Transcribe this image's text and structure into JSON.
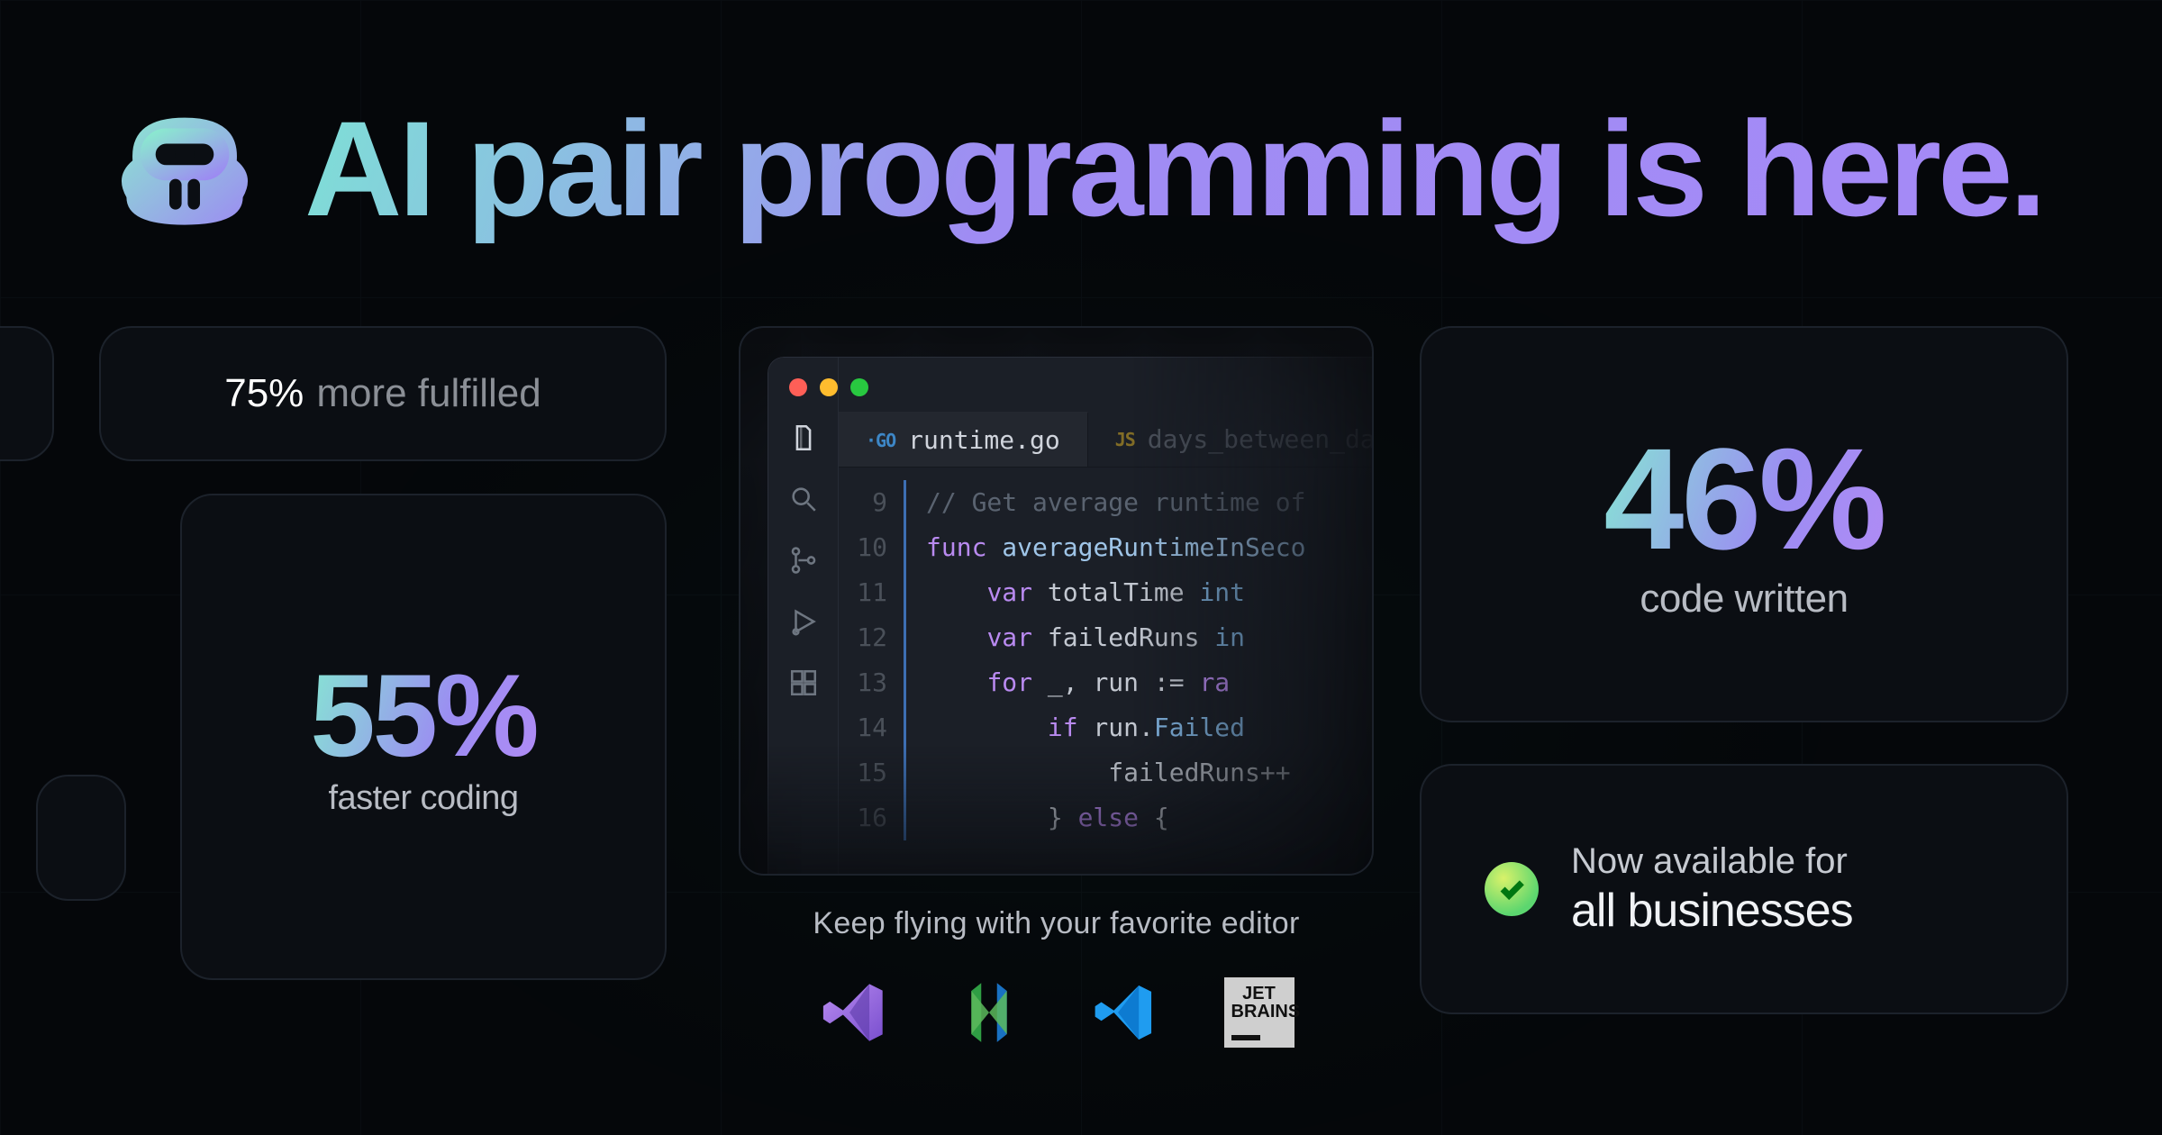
{
  "hero": {
    "title": "AI pair programming is here."
  },
  "stats": {
    "fulfilled": {
      "value": "75%",
      "label": "more fulfilled"
    },
    "faster": {
      "value": "55%",
      "label": "faster coding"
    },
    "written": {
      "value": "46%",
      "label": "code written"
    }
  },
  "availability": {
    "line1": "Now available for",
    "line2": "all businesses"
  },
  "editor": {
    "tabs": [
      {
        "lang": "GO",
        "name": "runtime.go",
        "active": true
      },
      {
        "lang": "JS",
        "name": "days_between_da",
        "active": false
      }
    ],
    "gutter_start": 9,
    "lines": [
      {
        "n": 9,
        "html": "<span class='c-comment'>// Get average runtime of</span>"
      },
      {
        "n": 10,
        "html": "<span class='c-kw'>func</span> <span class='c-fn'>averageRuntimeInSeco</span>"
      },
      {
        "n": 11,
        "html": "    <span class='c-kw'>var</span> <span class='c-ident'>totalTime</span> <span class='c-prop'>int</span>"
      },
      {
        "n": 12,
        "html": "    <span class='c-kw'>var</span> <span class='c-ident'>failedRuns</span> <span class='c-prop'>in</span>"
      },
      {
        "n": 13,
        "html": "    <span class='c-kw'>for</span> _, run := <span class='c-kw'>ra</span>"
      },
      {
        "n": 14,
        "html": "        <span class='c-kw'>if</span> run.<span class='c-prop'>Failed</span>"
      },
      {
        "n": 15,
        "html": "            failedRuns++"
      },
      {
        "n": 16,
        "html": "        } <span class='c-kw'>else</span> {"
      }
    ]
  },
  "editors_strip": {
    "caption": "Keep flying with your favorite editor",
    "logos": [
      "visual-studio",
      "neovim",
      "vscode",
      "jetbrains"
    ],
    "jetbrains_label": "JET\nBRAINS"
  },
  "icons": {
    "copilot": "copilot-logo-icon",
    "check": "check-icon"
  }
}
